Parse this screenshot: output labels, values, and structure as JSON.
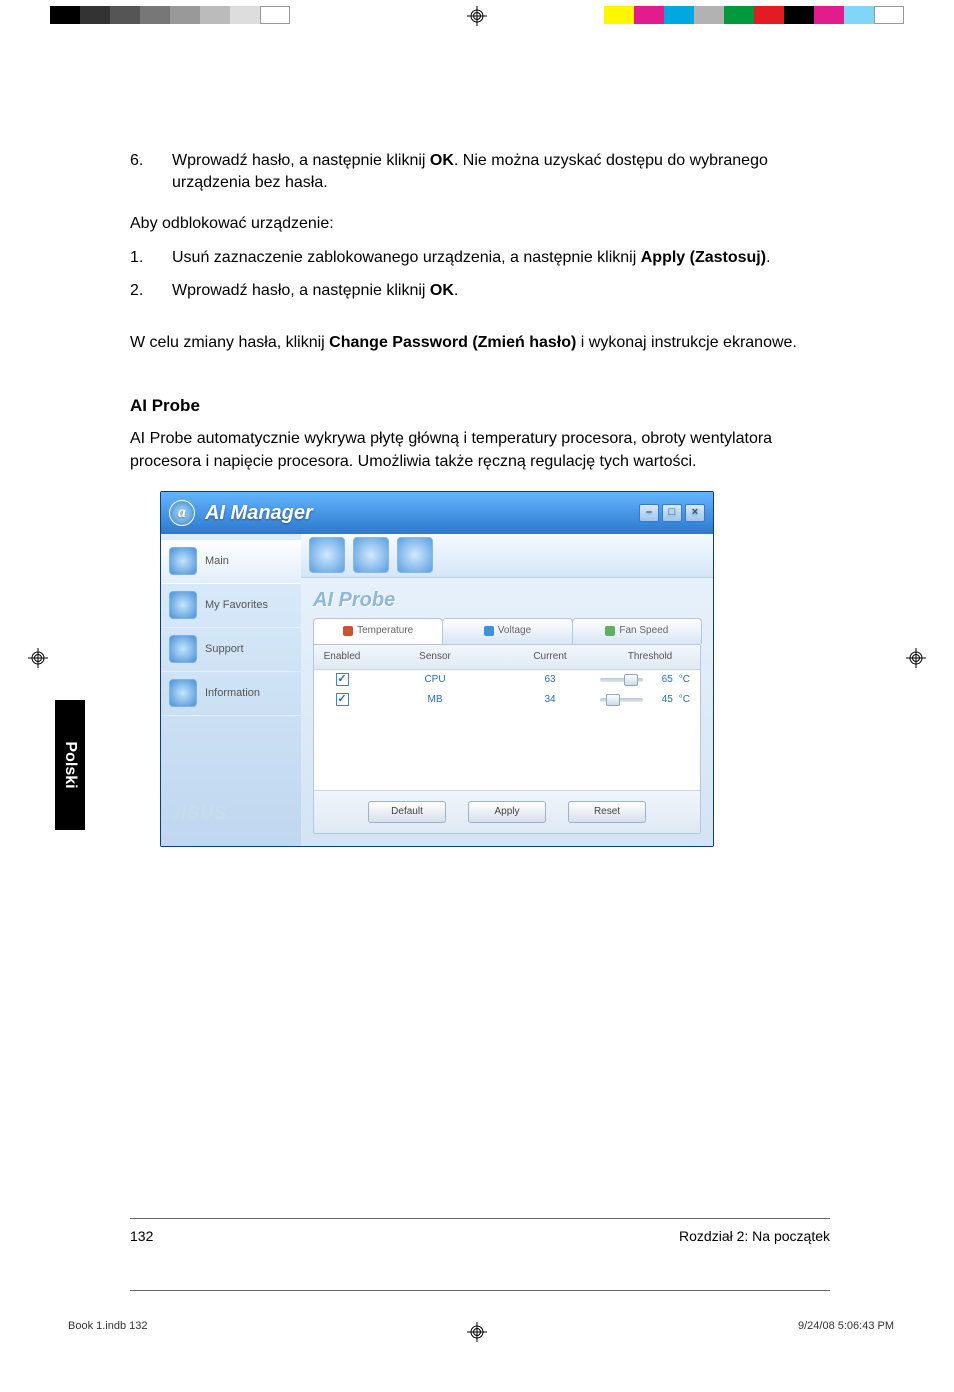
{
  "printbar_left": [
    "#000",
    "#333",
    "#555",
    "#777",
    "#999",
    "#bbb",
    "#ddd",
    "#fff"
  ],
  "printbar_right": [
    "#fff600",
    "#e31c8e",
    "#00a7e1",
    "#b2b2b2",
    "#009a3d",
    "#e31c23",
    "#000",
    "#e31c8e",
    "#80d6f7",
    "#fff"
  ],
  "step6": {
    "num": "6.",
    "pre": "Wprowadź hasło, a następnie kliknij ",
    "b": "OK",
    "post": ". Nie można uzyskać dostępu do wybranego urządzenia bez hasła."
  },
  "unlock_title": "Aby odblokować urządzenie:",
  "u1": {
    "num": "1.",
    "pre": "Usuń zaznaczenie zablokowanego urządzenia, a następnie kliknij ",
    "b": "Apply (Zastosuj)",
    "post": "."
  },
  "u2": {
    "num": "2.",
    "pre": "Wprowadź hasło, a następnie kliknij ",
    "b": "OK",
    "post": "."
  },
  "change": {
    "pre": "W celu zmiany hasła, kliknij ",
    "b": "Change Password (Zmień hasło)",
    "post": " i wykonaj instrukcje ekranowe."
  },
  "aiprobe_head": "AI Probe",
  "aiprobe_para": "AI Probe automatycznie wykrywa płytę główną i temperatury procesora, obroty wentylatora procesora i napięcie procesora. Umożliwia także ręczną regulację tych wartości.",
  "tab_label": "Polski",
  "app": {
    "title": "AI Manager",
    "logo": "a",
    "min": "–",
    "max": "□",
    "close": "×",
    "side": [
      {
        "label": "Main",
        "active": true
      },
      {
        "label": "My Favorites"
      },
      {
        "label": "Support"
      },
      {
        "label": "Information"
      }
    ],
    "brand": "/ISUS",
    "panel_title": "AI Probe",
    "tabs": [
      {
        "label": "Temperature",
        "active": true,
        "color": "#d05030"
      },
      {
        "label": "Voltage",
        "color": "#4090e0"
      },
      {
        "label": "Fan Speed",
        "color": "#60b060"
      }
    ],
    "columns": {
      "enabled": "Enabled",
      "sensor": "Sensor",
      "current": "Current",
      "threshold": "Threshold"
    },
    "rows": [
      {
        "sensor": "CPU",
        "current": "63",
        "thr": "65",
        "unit": "°C",
        "pos": 55
      },
      {
        "sensor": "MB",
        "current": "34",
        "thr": "45",
        "unit": "°C",
        "pos": 15
      }
    ],
    "buttons": {
      "default": "Default",
      "apply": "Apply",
      "reset": "Reset"
    }
  },
  "page_num": "132",
  "chapter": "Rozdział 2: Na początek",
  "slug": "Book 1.indb   132",
  "ts": "9/24/08   5:06:43 PM"
}
